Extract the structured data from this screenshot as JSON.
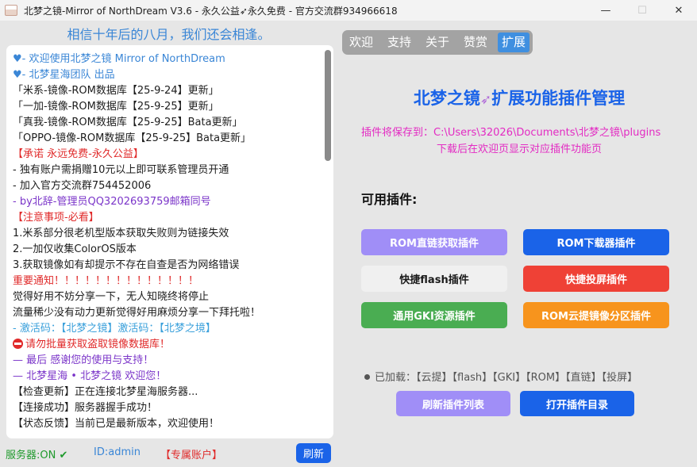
{
  "window": {
    "title": "北梦之镜-Mirror of NorthDream V3.6 - 永久公益➶永久免费 - 官方交流群934966618",
    "controls": [
      "—",
      "☐",
      "✕"
    ]
  },
  "left": {
    "motto": "相信十年后的八月，我们还会相逢。",
    "log_lines": [
      "♥- 欢迎使用北梦之镜 Mirror of NorthDream",
      "♥- 北梦星海团队 出品",
      "「米系-镜像-ROM数据库【25-9-24】更新」",
      "「一加-镜像-ROM数据库【25-9-25】更新」",
      "「真我-镜像-ROM数据库【25-9-25】Bata更新」",
      "「OPPO-镜像-ROM数据库【25-9-25】Bata更新」",
      "【承诺 永远免费-永久公益】",
      "- 独有账户需捐赠10元以上即可联系管理员开通",
      "- 加入官方交流群754452006",
      "- by北辞-管理员QQ3202693759邮箱同号",
      "【注意事项-必看】",
      "1.米系部分很老机型版本获取失败则为链接失效",
      "2.一加仅收集ColorOS版本",
      "3.获取镜像如有却提示不存在自查是否为网络错误",
      "重要通知！！！！！！！！！！！！！！",
      "觉得好用不妨分享一下，无人知晓终将停止",
      "流量稀少没有动力更新觉得好用麻烦分享一下拜托啦！",
      "- 激活码：【北梦之镜】激活码：【北梦之境】",
      "请勿批量获取盗取镜像数据库！",
      "— 最后 感谢您的使用与支持！",
      "— 北梦星海 • 北梦之镜 欢迎您！",
      "【检查更新】正在连接北梦星海服务器...",
      "【连接成功】服务器握手成功！",
      "【状态反馈】当前已是最新版本，欢迎使用！"
    ],
    "status": {
      "server": "服务器:ON",
      "server_check": "✔",
      "id": "ID:admin",
      "account": "【专属账户】"
    },
    "refresh_label": "刷新"
  },
  "right": {
    "tabs": [
      "欢迎",
      "支持",
      "关于",
      "赞赏",
      "扩展"
    ],
    "active_tab": "扩展",
    "title": "北梦之镜",
    "title_icon": "➶",
    "title_suffix": "扩展功能插件管理",
    "save_path": "插件将保存到：C:\\Users\\32026\\Documents\\北梦之镜\\plugins",
    "save_hint": "下载后在欢迎页显示对应插件功能页",
    "available_label": "可用插件:",
    "plugins": [
      {
        "label": "ROM直链获取插件",
        "color": "#a08ef7"
      },
      {
        "label": "ROM下载器插件",
        "color": "#1a63e8"
      },
      {
        "label": "快捷flash插件",
        "color": "#f0f0f0"
      },
      {
        "label": "快捷投屏插件",
        "color": "#ef4136"
      },
      {
        "label": "通用GKI资源插件",
        "color": "#4aad52"
      },
      {
        "label": "ROM云提镜像分区插件",
        "color": "#f7941d"
      }
    ],
    "loaded": "已加载：【云提】【flash】【GKI】【ROM】【直链】【投屏】",
    "refresh_plugins_label": "刷新插件列表",
    "open_dir_label": "打开插件目录"
  }
}
